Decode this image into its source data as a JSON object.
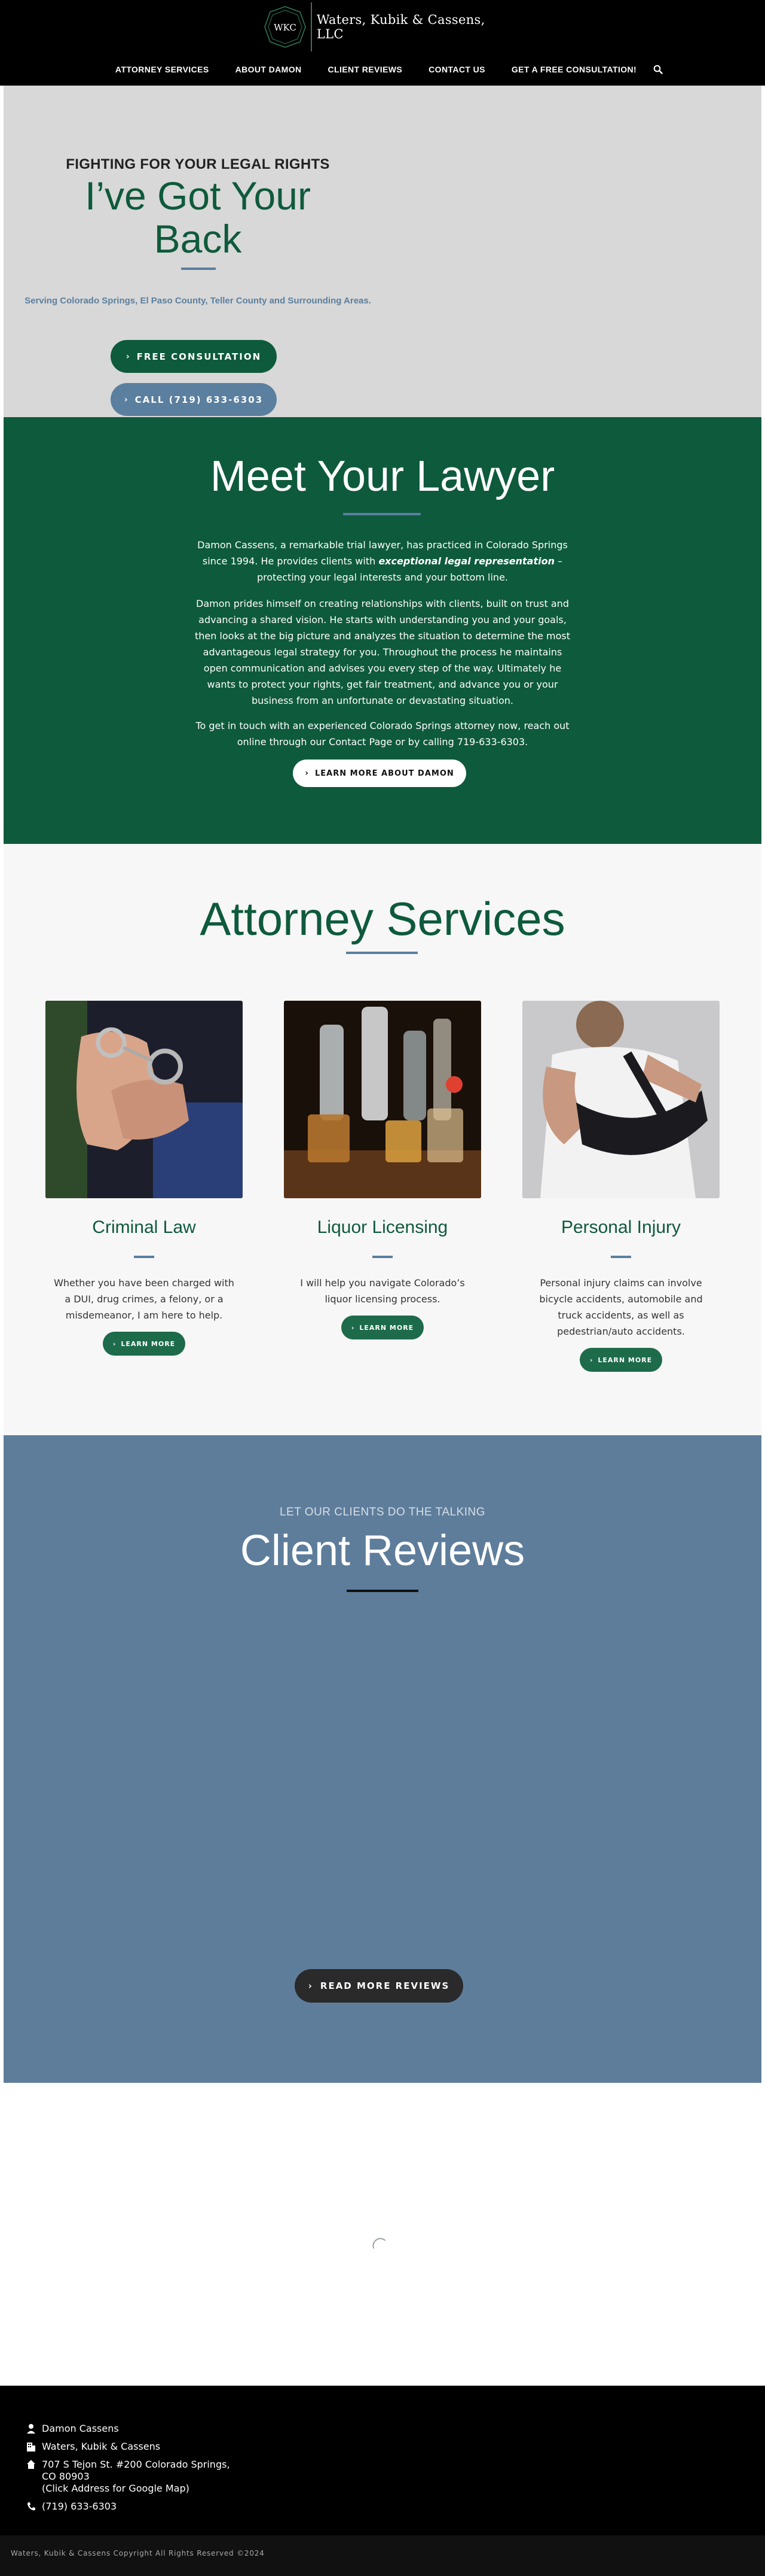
{
  "header": {
    "logo_monogram": "WKC",
    "firm_name": "Waters, Kubik & Cassens, LLC",
    "nav": [
      {
        "label": "ATTORNEY SERVICES"
      },
      {
        "label": "ABOUT DAMON"
      },
      {
        "label": "CLIENT REVIEWS"
      },
      {
        "label": "CONTACT US"
      },
      {
        "label": "GET A FREE CONSULTATION!"
      }
    ],
    "search_icon": "search-icon"
  },
  "hero": {
    "kicker": "FIGHTING FOR YOUR LEGAL RIGHTS",
    "title_line1": "I’ve Got Your",
    "title_line2": "Back",
    "subtitle": "Serving Colorado Springs, El Paso County, Teller County and Surrounding Areas.",
    "consult_button": "FREE CONSULTATION",
    "call_button": "CALL (719) 633-6303"
  },
  "meet": {
    "title": "Meet Your Lawyer",
    "p1_before": "Damon Cassens, a remarkable trial lawyer, has practiced in Colorado Springs since 1994. He provides clients with ",
    "p1_emphasis": "exceptional legal representation",
    "p1_after": " – protecting your legal interests and your bottom line.",
    "p2": "Damon prides himself on creating relationships with clients, built on trust and advancing a shared vision. He starts with understanding you and your goals, then looks at the big picture and analyzes the situation to determine the most advantageous legal strategy for you. Throughout the process he maintains open communication and advises you every step of the way. Ultimately he wants to protect your rights, get fair treatment, and advance you or your business from an unfortunate or devastating situation.",
    "p3": "To get in touch with an experienced Colorado Springs attorney now, reach out online through our Contact Page or by calling 719-633-6303.",
    "button": "LEARN MORE ABOUT DAMON"
  },
  "services": {
    "title": "Attorney Services",
    "cards": [
      {
        "title": "Criminal Law",
        "text": "Whether you have been charged with a DUI, drug crimes, a felony, or a misdemeanor, I am here to help.",
        "button": "LEARN MORE"
      },
      {
        "title": "Liquor Licensing",
        "text": "I will help you navigate Colorado’s liquor licensing process.",
        "button": "LEARN MORE"
      },
      {
        "title": "Personal Injury",
        "text": "Personal injury claims can involve bicycle accidents, automobile and truck accidents, as well as pedestrian/auto accidents.",
        "button": "LEARN MORE"
      }
    ]
  },
  "reviews": {
    "kicker": "LET OUR CLIENTS DO THE TALKING",
    "title": "Client Reviews",
    "button": "READ MORE REVIEWS"
  },
  "footer": {
    "name": "Damon Cassens",
    "firm": "Waters, Kubik & Cassens",
    "address_line1": "707 S Tejon St. #200 Colorado Springs,",
    "address_line2": "CO 80903",
    "address_line3": "(Click Address for Google Map)",
    "phone": "(719) 633-6303",
    "copyright": "Waters, Kubik & Cassens Copyright All Rights Reserved ©2024"
  },
  "colors": {
    "brand_green": "#0e5a3c",
    "accent_blue": "#5b7f9e",
    "reviews_bg": "#5e7d9b"
  }
}
